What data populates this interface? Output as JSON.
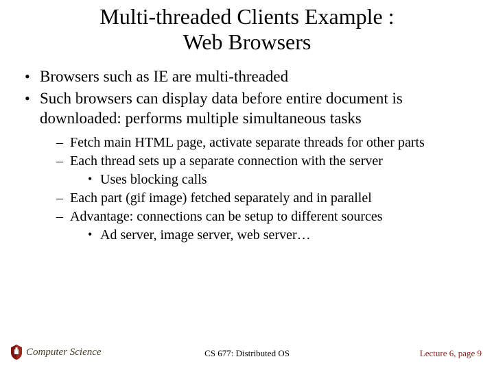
{
  "title_line1": "Multi-threaded Clients Example :",
  "title_line2": "Web Browsers",
  "bullets": {
    "b1": "Browsers such as IE are multi-threaded",
    "b2": "Such browsers can display data before entire document is downloaded: performs multiple simultaneous tasks",
    "s1": "Fetch main HTML page, activate separate threads for other parts",
    "s2": "Each thread sets up a separate connection with the server",
    "s2a": "Uses blocking calls",
    "s3": "Each part (gif image) fetched separately and in parallel",
    "s4": "Advantage: connections can be setup to different sources",
    "s4a": "Ad server, image server, web server…"
  },
  "footer": {
    "dept": "Computer Science",
    "course": "CS 677: Distributed OS",
    "page": "Lecture 6, page 9"
  }
}
